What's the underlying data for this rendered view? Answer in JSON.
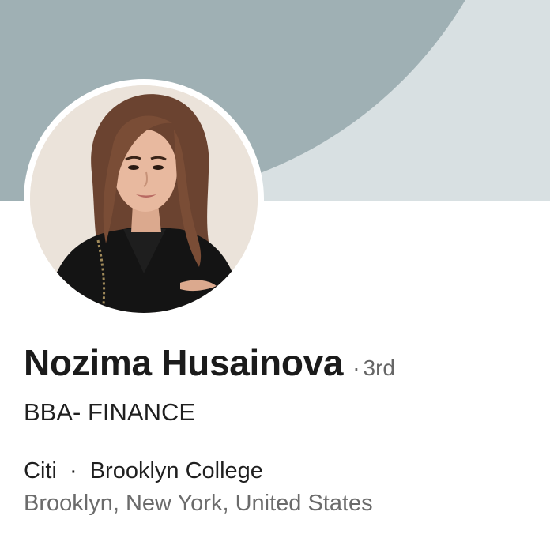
{
  "profile": {
    "name": "Nozima Husainova",
    "degree_separator": "·",
    "connection_degree": "3rd",
    "headline": "BBA- FINANCE",
    "company": "Citi",
    "company_separator": "·",
    "school": "Brooklyn College",
    "location": "Brooklyn, New York, United States"
  },
  "colors": {
    "cover_background": "#d8e0e2",
    "cover_shape": "#9fb0b4",
    "name_text": "#1b1b1b",
    "secondary_text": "#6b6b6b"
  },
  "icons": {
    "avatar": "profile-photo"
  }
}
